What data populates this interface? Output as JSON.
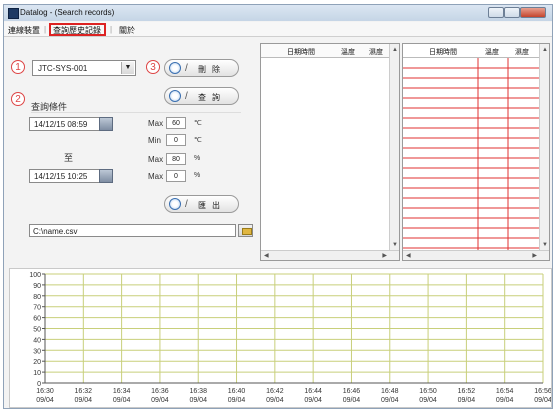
{
  "window": {
    "title": "Datalog - (Search records)"
  },
  "menu": {
    "items": [
      "連線裝置",
      "查詢歷史記錄",
      "關於"
    ]
  },
  "markers": [
    "1",
    "2",
    "3"
  ],
  "device": {
    "selected": "JTC-SYS-001"
  },
  "buttons": {
    "delete": "刪除",
    "query": "查詢",
    "export": "匯出"
  },
  "query": {
    "section_label": "查詢條件",
    "start": "14/12/15 08:59",
    "to_label": "至",
    "end": "14/12/15 10:25",
    "limits": [
      {
        "label": "Max",
        "value": "60",
        "unit": "℃"
      },
      {
        "label": "Min",
        "value": "0",
        "unit": "℃"
      },
      {
        "label": "Max",
        "value": "80",
        "unit": "%"
      },
      {
        "label": "Max",
        "value": "0",
        "unit": "%"
      }
    ]
  },
  "export_path": "C:\\name.csv",
  "table": {
    "headers": [
      "日期時間",
      "溫度",
      "濕度"
    ]
  },
  "colors": {
    "accent_red": "#e03030",
    "chart_line": "#c8cf7a",
    "highlight": "#d22222"
  },
  "chart_data": {
    "type": "line",
    "title": "",
    "xlabel": "",
    "ylabel": "",
    "y_ticks": [
      0,
      10,
      20,
      30,
      40,
      50,
      60,
      70,
      80,
      90,
      100
    ],
    "ylim": [
      0,
      100
    ],
    "x_ticks": [
      {
        "time": "16:30",
        "date": "09/04"
      },
      {
        "time": "16:32",
        "date": "09/04"
      },
      {
        "time": "16:34",
        "date": "09/04"
      },
      {
        "time": "16:36",
        "date": "09/04"
      },
      {
        "time": "16:38",
        "date": "09/04"
      },
      {
        "time": "16:40",
        "date": "09/04"
      },
      {
        "time": "16:42",
        "date": "09/04"
      },
      {
        "time": "16:44",
        "date": "09/04"
      },
      {
        "time": "16:46",
        "date": "09/04"
      },
      {
        "time": "16:48",
        "date": "09/04"
      },
      {
        "time": "16:50",
        "date": "09/04"
      },
      {
        "time": "16:52",
        "date": "09/04"
      },
      {
        "time": "16:54",
        "date": "09/04"
      },
      {
        "time": "16:56",
        "date": "09/04"
      }
    ],
    "series": [],
    "grid": true
  }
}
